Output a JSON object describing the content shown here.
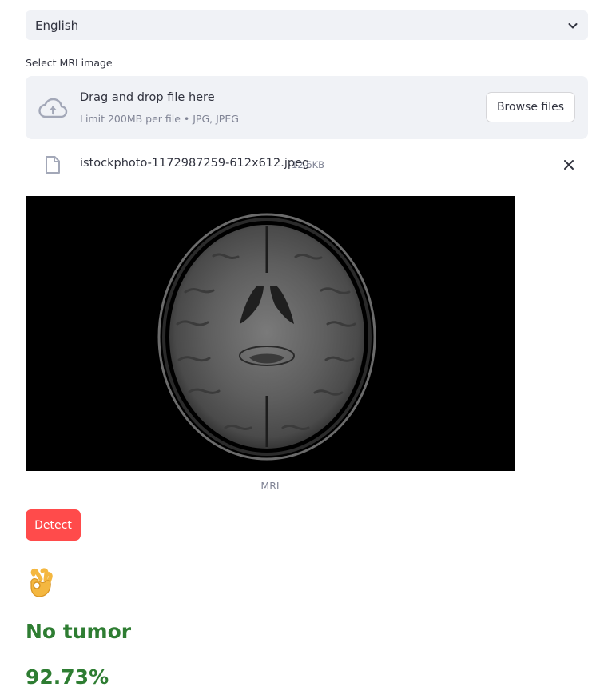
{
  "language_select": {
    "selected": "English"
  },
  "uploader": {
    "label": "Select MRI image",
    "drop_title": "Drag and drop file here",
    "drop_limits": "Limit 200MB per file • JPG, JPEG",
    "browse_label": "Browse files"
  },
  "uploaded_file": {
    "name": "istockphoto-1172987259-612x612.jpeg",
    "size": "12.6KB"
  },
  "image": {
    "caption": "MRI"
  },
  "actions": {
    "detect_label": "Detect"
  },
  "result": {
    "label": "No tumor",
    "confidence": "92.73%"
  },
  "colors": {
    "accent": "#ff4b4b",
    "success": "#2e7d32",
    "panel_bg": "#f0f2f6"
  },
  "icons": {
    "select": "chevron-down-icon",
    "dropzone": "cloud-upload-icon",
    "file": "file-icon",
    "remove": "close-icon",
    "result": "ok-hand-emoji"
  }
}
